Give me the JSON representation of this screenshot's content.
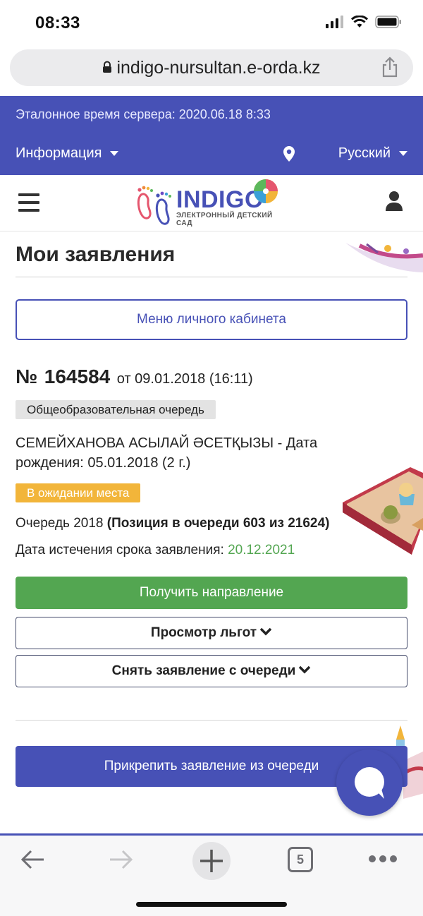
{
  "status_bar": {
    "time": "08:33"
  },
  "browser": {
    "url": "indigo-nursultan.e-orda.kz",
    "tab_count": "5"
  },
  "header": {
    "server_time": "Эталонное время сервера: 2020.06.18 8:33",
    "info_menu": "Информация",
    "language": "Русский"
  },
  "logo": {
    "title": "INDIGO",
    "subtitle": "ЭЛЕКТРОННЫЙ ДЕТСКИЙ САД"
  },
  "page": {
    "title": "Мои заявления",
    "menu_button": "Меню личного кабинета"
  },
  "application": {
    "number_prefix": "№",
    "number": "164584",
    "date_text": "от 09.01.2018 (16:11)",
    "queue_type": "Общеобразовательная очередь",
    "child_name": "СЕМЕЙХАНОВА АСЫЛАЙ ӘСЕТҚЫЗЫ",
    "child_birth": " - Дата рождения: 05.01.2018 (2 г.)",
    "status": "В ожидании места",
    "queue_label": "Очередь 2018",
    "queue_position": "(Позиция в очереди 603 из 21624)",
    "expire_label": "Дата истечения срока заявления:",
    "expire_date": "20.12.2021"
  },
  "actions": {
    "get_direction": "Получить направление",
    "view_benefits": "Просмотр льгот",
    "withdraw": "Снять заявление с очереди",
    "attach": "Прикрепить заявление из очереди"
  },
  "colors": {
    "brand": "#4751b6",
    "success": "#53a651",
    "warning": "#f2b53a"
  }
}
